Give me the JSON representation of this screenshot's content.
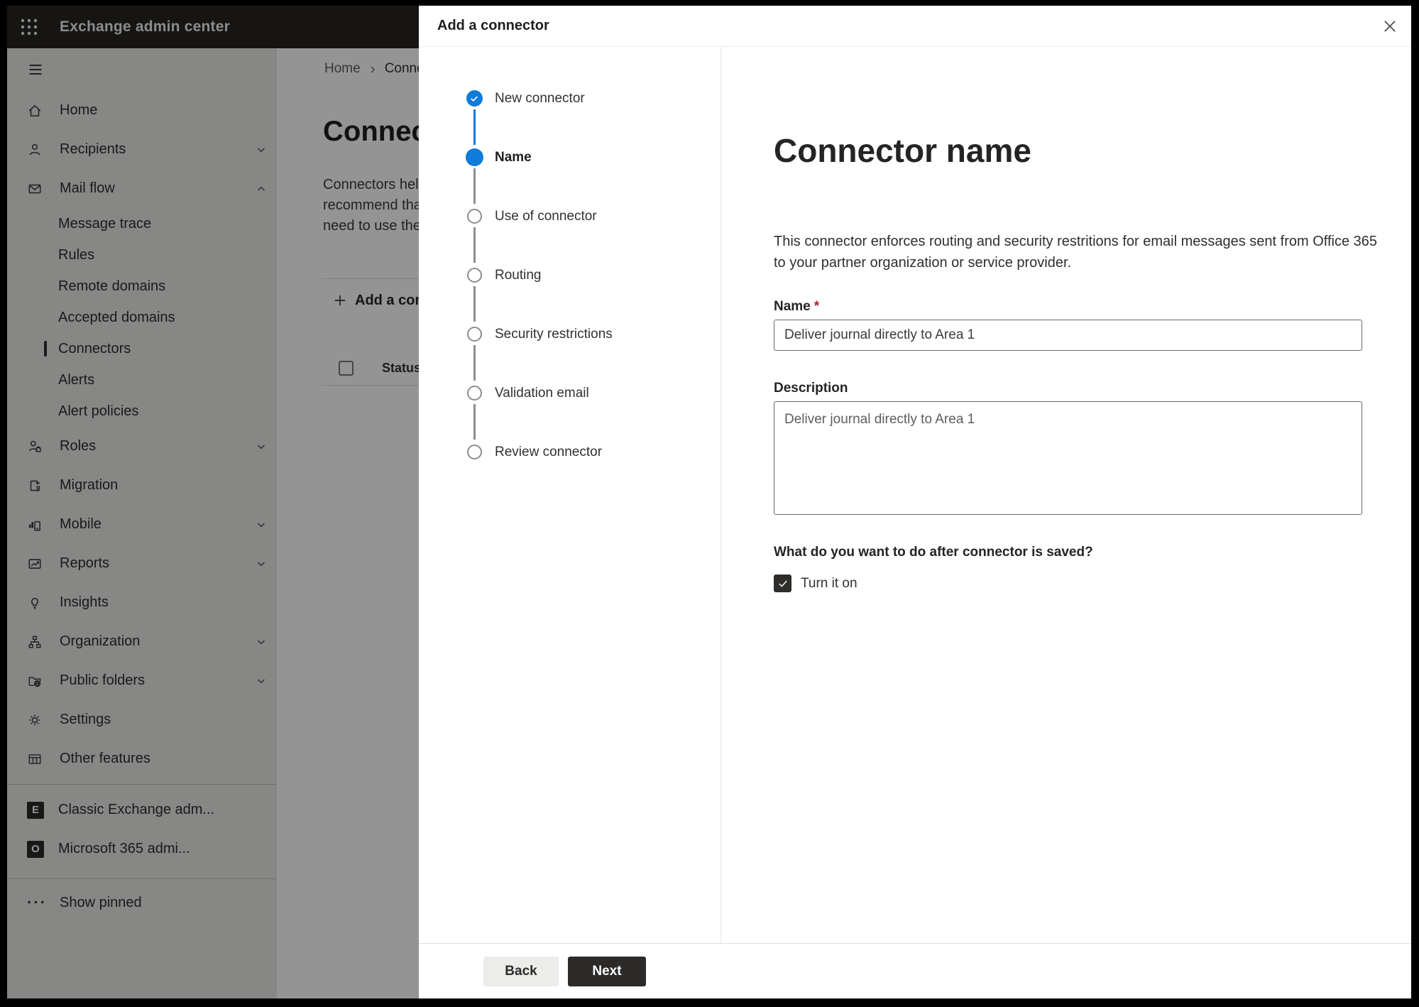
{
  "colors": {
    "accent": "#0f7bda",
    "required": "#a4262c",
    "header_bg": "#262524",
    "next_button_bg": "#2b2a29"
  },
  "header": {
    "title": "Exchange admin center"
  },
  "sidebar": {
    "items": [
      {
        "label": "Home",
        "icon": "home-icon"
      },
      {
        "label": "Recipients",
        "icon": "person-icon"
      },
      {
        "label": "Mail flow",
        "icon": "mail-icon"
      },
      {
        "label": "Message trace"
      },
      {
        "label": "Rules"
      },
      {
        "label": "Remote domains"
      },
      {
        "label": "Accepted domains"
      },
      {
        "label": "Connectors",
        "selected": true
      },
      {
        "label": "Alerts"
      },
      {
        "label": "Alert policies"
      },
      {
        "label": "Roles",
        "icon": "person-badge-icon"
      },
      {
        "label": "Migration",
        "icon": "migration-icon"
      },
      {
        "label": "Mobile",
        "icon": "mobile-icon"
      },
      {
        "label": "Reports",
        "icon": "reports-icon"
      },
      {
        "label": "Insights",
        "icon": "lightbulb-icon"
      },
      {
        "label": "Organization",
        "icon": "org-chart-icon"
      },
      {
        "label": "Public folders",
        "icon": "folder-globe-icon"
      },
      {
        "label": "Settings",
        "icon": "gear-icon"
      },
      {
        "label": "Other features",
        "icon": "table-icon"
      }
    ],
    "secondary": [
      {
        "label": "Classic Exchange adm...",
        "icon": "exchange-logo-icon",
        "logo_letter": "E"
      },
      {
        "label": "Microsoft 365 admi...",
        "icon": "microsoft-365-logo-icon",
        "logo_letter": "O"
      }
    ],
    "show_pinned": {
      "label": "Show pinned",
      "ellipsis": "···"
    }
  },
  "page": {
    "breadcrumb": [
      "Home",
      "Conne"
    ],
    "title": "Connect",
    "intro_lines": [
      "Connectors help",
      "recommend that",
      "need to use ther"
    ],
    "add_button_label": "Add a conn",
    "status_column": "Status"
  },
  "modal": {
    "title": "Add a connector",
    "steps": [
      {
        "label": "New connector",
        "state": "completed"
      },
      {
        "label": "Name",
        "state": "current"
      },
      {
        "label": "Use of connector",
        "state": "upcoming"
      },
      {
        "label": "Routing",
        "state": "upcoming"
      },
      {
        "label": "Security restrictions",
        "state": "upcoming"
      },
      {
        "label": "Validation email",
        "state": "upcoming"
      },
      {
        "label": "Review connector",
        "state": "upcoming"
      }
    ],
    "content": {
      "heading": "Connector name",
      "lead": "This connector enforces routing and security restritions for email messages sent from Office 365 to your partner organization or service provider.",
      "name_label": "Name",
      "required_marker": "*",
      "name_value": "Deliver journal directly to Area 1",
      "description_label": "Description",
      "description_value": "Deliver journal directly to Area 1",
      "after_save_question": "What do you want to do after connector is saved?",
      "turn_on_label": "Turn it on",
      "turn_on_checked": true
    },
    "footer": {
      "back_label": "Back",
      "next_label": "Next"
    }
  }
}
